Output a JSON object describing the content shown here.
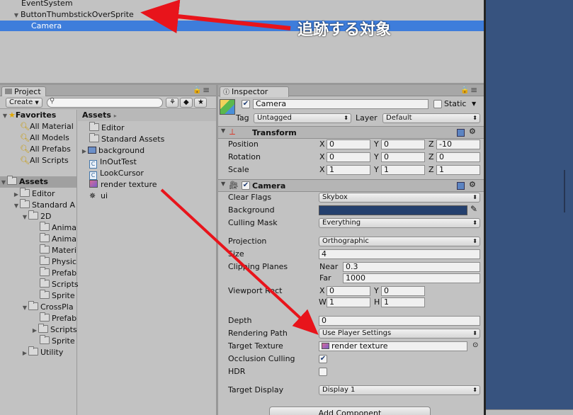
{
  "hierarchy": {
    "items": [
      {
        "label": "EventSystem"
      },
      {
        "label": "ButtonThumbstickOverSprite"
      },
      {
        "label": "Camera"
      }
    ]
  },
  "annotation": {
    "text": "追跡する対象"
  },
  "project": {
    "tab": "Project",
    "create_label": "Create",
    "search_placeholder": "",
    "favorites_label": "Favorites",
    "favorites": [
      "All Material",
      "All Models",
      "All Prefabs",
      "All Scripts"
    ],
    "assets_label": "Assets",
    "tree": [
      "Editor",
      "Standard A",
      "2D",
      "Anima",
      "Anima",
      "Materi",
      "Physic",
      "Prefab",
      "Scripts",
      "Sprite",
      "CrossPla",
      "Prefab",
      "Scripts",
      "Sprite",
      "Utility"
    ],
    "breadcrumb": "Assets",
    "files": [
      "Editor",
      "Standard Assets",
      "background",
      "InOutTest",
      "LookCursor",
      "render texture",
      "ui"
    ]
  },
  "inspector": {
    "tab": "Inspector",
    "object_name": "Camera",
    "static_label": "Static",
    "tag_label": "Tag",
    "tag_value": "Untagged",
    "layer_label": "Layer",
    "layer_value": "Default",
    "transform": {
      "title": "Transform",
      "position_label": "Position",
      "position": {
        "x": "0",
        "y": "0",
        "z": "-10"
      },
      "rotation_label": "Rotation",
      "rotation": {
        "x": "0",
        "y": "0",
        "z": "0"
      },
      "scale_label": "Scale",
      "scale": {
        "x": "1",
        "y": "1",
        "z": "1"
      }
    },
    "camera": {
      "title": "Camera",
      "clear_flags_label": "Clear Flags",
      "clear_flags": "Skybox",
      "background_label": "Background",
      "background_color": "#24406e",
      "culling_mask_label": "Culling Mask",
      "culling_mask": "Everything",
      "projection_label": "Projection",
      "projection": "Orthographic",
      "size_label": "Size",
      "size": "4",
      "clipping_label": "Clipping Planes",
      "near_label": "Near",
      "near": "0.3",
      "far_label": "Far",
      "far": "1000",
      "viewport_label": "Viewport Rect",
      "viewport": {
        "x": "0",
        "y": "0",
        "w": "1",
        "h": "1"
      },
      "depth_label": "Depth",
      "depth": "0",
      "rendering_path_label": "Rendering Path",
      "rendering_path": "Use Player Settings",
      "target_texture_label": "Target Texture",
      "target_texture": "render texture",
      "occlusion_label": "Occlusion Culling",
      "hdr_label": "HDR",
      "target_display_label": "Target Display",
      "target_display": "Display 1"
    },
    "add_component": "Add Component"
  },
  "axis_letters": {
    "x": "X",
    "y": "Y",
    "z": "Z",
    "w": "W",
    "h": "H"
  },
  "colors": {
    "selection": "#3e7ddb",
    "arrow": "#e8141b",
    "scene": "#37537f"
  }
}
